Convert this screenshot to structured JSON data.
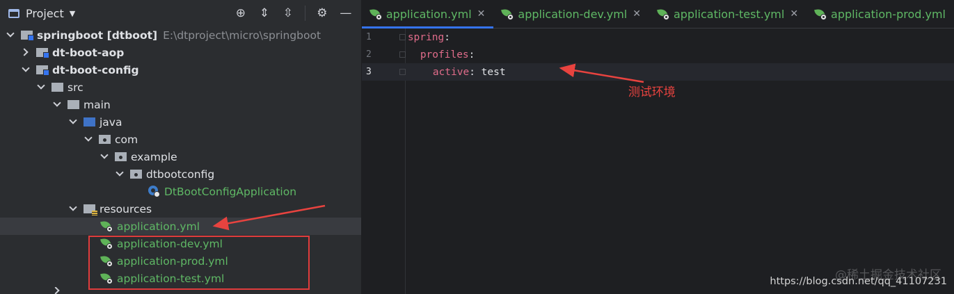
{
  "panel": {
    "title": "Project",
    "tools": [
      "locate-icon",
      "expand-all-icon",
      "collapse-all-icon",
      "gear-icon",
      "minimize-icon"
    ]
  },
  "tree": [
    {
      "label": "springboot [dtboot]",
      "path": "E:\\dtproject\\micro\\springboot"
    },
    {
      "label": "dt-boot-aop"
    },
    {
      "label": "dt-boot-config"
    },
    {
      "label": "src"
    },
    {
      "label": "main"
    },
    {
      "label": "java"
    },
    {
      "label": "com"
    },
    {
      "label": "example"
    },
    {
      "label": "dtbootconfig"
    },
    {
      "label": "DtBootConfigApplication"
    },
    {
      "label": "resources"
    },
    {
      "label": "application.yml"
    },
    {
      "label": "application-dev.yml"
    },
    {
      "label": "application-prod.yml"
    },
    {
      "label": "application-test.yml"
    }
  ],
  "tabs": [
    {
      "label": "application.yml"
    },
    {
      "label": "application-dev.yml"
    },
    {
      "label": "application-test.yml"
    },
    {
      "label": "application-prod.yml"
    }
  ],
  "code": [
    {
      "num": "1",
      "key": "spring",
      "colon": ":"
    },
    {
      "num": "2",
      "key": "profiles",
      "colon": ":"
    },
    {
      "num": "3",
      "key": "active",
      "colon": ":",
      "value": "test"
    }
  ],
  "annotation": "测试环境",
  "watermark": "https://blog.csdn.net/qq_41107231",
  "watermark_cn": "@稀土掘金技术社区",
  "colors": {
    "accent": "#3574f0",
    "annotation": "#e8433f",
    "file_green": "#5fb865"
  }
}
